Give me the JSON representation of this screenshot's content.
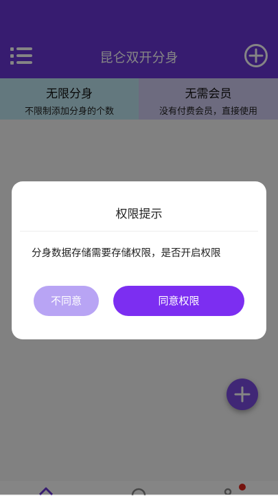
{
  "header": {
    "title": "昆仑双开分身",
    "menu_icon": "menu-icon",
    "add_icon": "add-circle-icon"
  },
  "banner": {
    "left": {
      "title": "无限分身",
      "subtitle": "不限制添加分身的个数"
    },
    "right": {
      "title": "无需会员",
      "subtitle": "没有付费会员，直接使用"
    }
  },
  "fab": {
    "icon": "plus-icon"
  },
  "tabbar": {
    "icons": [
      "home-icon",
      "search-icon",
      "user-icon"
    ],
    "badge": "red-dot"
  },
  "dialog": {
    "title": "权限提示",
    "message": "分身数据存储需要存储权限，是否开启权限",
    "decline_label": "不同意",
    "agree_label": "同意权限"
  },
  "colors": {
    "header": "#6a36d6",
    "accent": "#7c2ef1",
    "accent_light": "#b8a4f4",
    "banner_left": "#bfe7f1",
    "banner_right": "#d2cdf4"
  }
}
